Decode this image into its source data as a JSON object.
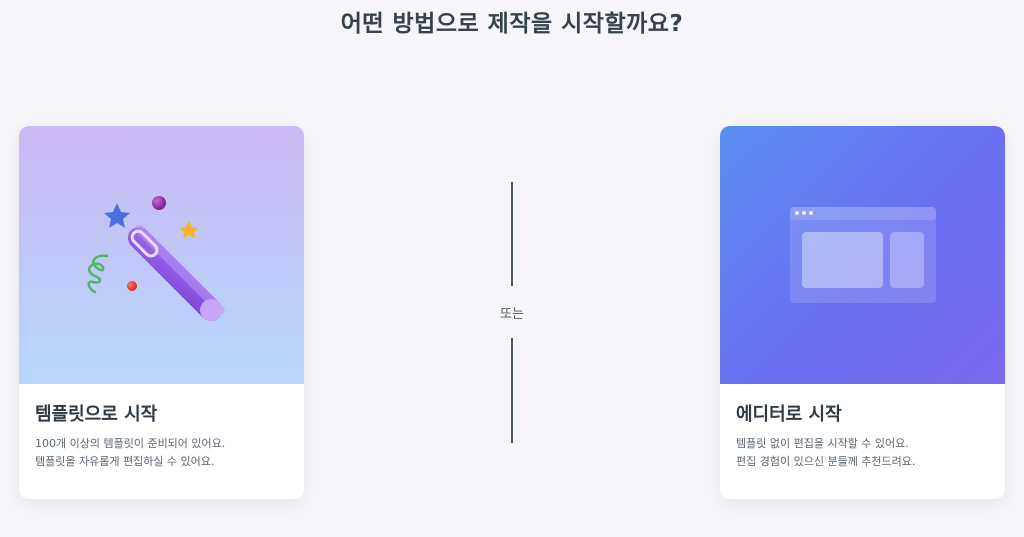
{
  "page": {
    "title": "어떤 방법으로 제작을 시작할까요?"
  },
  "template_card": {
    "title": "템플릿으로 시작",
    "desc_line1": "100개 이상의 템플릿이 준비되어 있어요.",
    "desc_line2": "템플릿을 자유롭게 편집하실 수 있어요.",
    "icon": "magic-wand-icon"
  },
  "divider": {
    "label": "또는"
  },
  "editor_card": {
    "title": "에디터로 시작",
    "desc_line1": "템플릿 없이 편집을 시작할 수 있어요.",
    "desc_line2": "편집 경험이 있으신 분들께 추천드려요.",
    "icon": "browser-window-icon"
  },
  "colors": {
    "background": "#f6f5fa",
    "text_primary": "#36434d",
    "template_gradient_top": "#cbb9f3",
    "template_gradient_bottom": "#b8d7fb",
    "editor_gradient_start": "#5a8ef0",
    "editor_gradient_end": "#7b69ee"
  }
}
